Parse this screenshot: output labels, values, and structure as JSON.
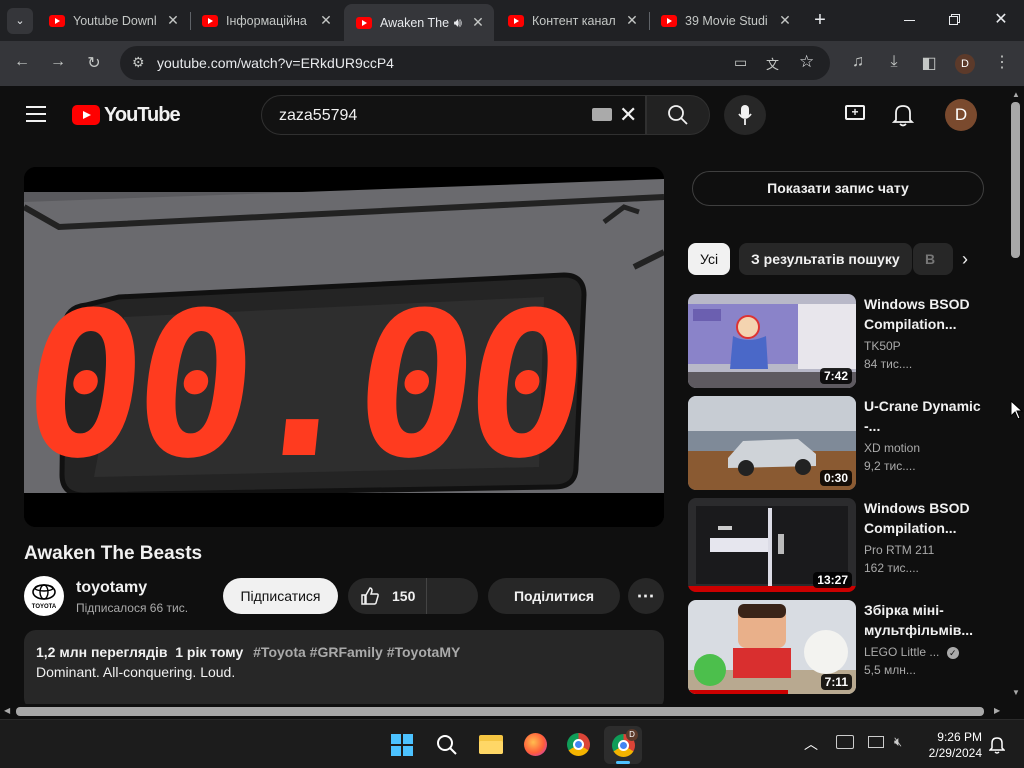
{
  "browser": {
    "tabs": [
      {
        "title": "Youtube Downl"
      },
      {
        "title": "Інформаційна"
      },
      {
        "title": "Awaken The"
      },
      {
        "title": "Контент канал"
      },
      {
        "title": "39 Movie Studi"
      }
    ],
    "url": "youtube.com/watch?v=ERkdUR9ccP4",
    "profile_initial": "D"
  },
  "youtube": {
    "logo_text": "YouTube",
    "search_value": "zaza55794",
    "avatar_initial": "D"
  },
  "video": {
    "title": "Awaken The Beasts",
    "channel": "toyotamy",
    "subscribers": "Підписалося 66 тис.",
    "subscribe_label": "Підписатися",
    "likes": "150",
    "share_label": "Поділитися",
    "views_line": "1,2 млн переглядів  1 рік тому",
    "hashtags": "#Toyota #GRFamily #ToyotaMY",
    "description": "Dominant. All-conquering. Loud.",
    "display_time": "00.00",
    "channel_logo_text": "TOYOTA"
  },
  "sidebar": {
    "chat_button": "Показати запис чату",
    "chips": [
      "Усі",
      "З результатів пошуку",
      "В"
    ],
    "recommendations": [
      {
        "title": "Windows BSOD Compilation...",
        "channel": "TK50P",
        "views": "84 тис....",
        "duration": "7:42"
      },
      {
        "title": "U-Crane Dynamic -...",
        "channel": "XD motion",
        "views": "9,2 тис....",
        "duration": "0:30"
      },
      {
        "title": "Windows BSOD Compilation...",
        "channel": "Pro RTM 211",
        "views": "162 тис....",
        "duration": "13:27"
      },
      {
        "title": "Збірка міні-мультфільмів...",
        "channel": "LEGO Little ...",
        "views": "5,5 млн...",
        "duration": "7:11"
      }
    ]
  },
  "taskbar": {
    "time": "9:26 PM",
    "date": "2/29/2024"
  },
  "colors": {
    "youtube_red": "#ff0000",
    "digit_red": "#ff3b1f",
    "background": "#0f0f0f"
  }
}
